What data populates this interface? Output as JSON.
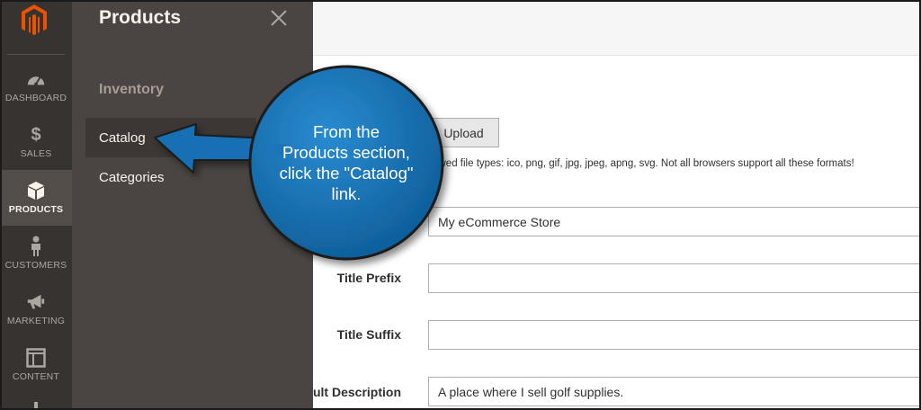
{
  "admin_nav": {
    "items": [
      {
        "label": "DASHBOARD",
        "icon": "dashboard-icon"
      },
      {
        "label": "SALES",
        "icon": "dollar-icon"
      },
      {
        "label": "PRODUCTS",
        "icon": "cube-icon"
      },
      {
        "label": "CUSTOMERS",
        "icon": "person-icon"
      },
      {
        "label": "MARKETING",
        "icon": "megaphone-icon"
      },
      {
        "label": "CONTENT",
        "icon": "layout-icon"
      }
    ],
    "active": "PRODUCTS"
  },
  "flyout": {
    "title": "Products",
    "section": "Inventory",
    "links": [
      {
        "label": "Catalog"
      },
      {
        "label": "Categories"
      }
    ]
  },
  "form": {
    "upload_label": "Upload",
    "hint": "llowed file types: ico, png, gif, jpg, jpeg, apng, svg. Not all browsers support all these formats!",
    "fields": [
      {
        "label": "",
        "value": "My eCommerce Store"
      },
      {
        "label": "Title Prefix",
        "value": ""
      },
      {
        "label": "Title Suffix",
        "value": ""
      },
      {
        "label": "ult Description",
        "value": "A place where I sell golf supplies."
      }
    ]
  },
  "callout": {
    "lines": [
      "From the",
      "Products section,",
      "click the \"Catalog\"",
      "link."
    ]
  },
  "colors": {
    "nav_bg": "#373330",
    "flyout_bg": "#4a4542",
    "brand_orange": "#eb5202",
    "callout_blue": "#1470b3"
  }
}
